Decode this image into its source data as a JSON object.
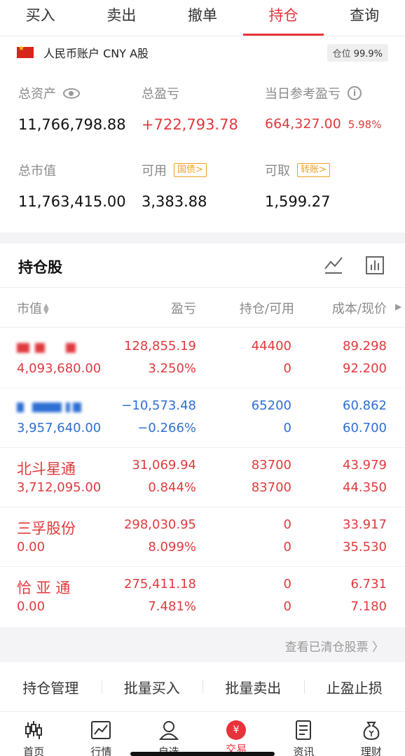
{
  "tabs": [
    {
      "label": "买入"
    },
    {
      "label": "卖出"
    },
    {
      "label": "撤单"
    },
    {
      "label": "持仓"
    },
    {
      "label": "查询"
    }
  ],
  "account": {
    "name": "人民币账户 CNY A股",
    "position_label": "仓位",
    "position_value": "99.9%",
    "total_assets_label": "总资产",
    "total_assets": "11,766,798.88",
    "total_pnl_label": "总盈亏",
    "total_pnl": "+722,793.78",
    "daily_pnl_label": "当日参考盈亏",
    "daily_pnl": "664,327.00",
    "daily_pnl_pct": "5.98%",
    "market_value_label": "总市值",
    "market_value": "11,763,415.00",
    "available_label": "可用",
    "available_tag": "国债>",
    "available": "3,383.88",
    "withdrawable_label": "可取",
    "withdrawable_tag": "转账>",
    "withdrawable": "1,599.27"
  },
  "holdings": {
    "title": "持仓股",
    "columns": [
      "市值",
      "盈亏",
      "持仓/可用",
      "成本/现价"
    ],
    "rows": [
      {
        "name": "",
        "market_value": "4,093,680.00",
        "pnl": "128,855.19",
        "pnl_pct": "3.250%",
        "holding": "44400",
        "available": "0",
        "cost": "89.298",
        "price": "92.200",
        "color": "#e03a3e"
      },
      {
        "name": "",
        "market_value": "3,957,640.00",
        "pnl": "−10,573.48",
        "pnl_pct": "−0.266%",
        "holding": "65200",
        "available": "0",
        "cost": "60.862",
        "price": "60.700",
        "color": "#2e6fd3"
      },
      {
        "name": "北斗星通",
        "market_value": "3,712,095.00",
        "pnl": "31,069.94",
        "pnl_pct": "0.844%",
        "holding": "83700",
        "available": "83700",
        "cost": "43.979",
        "price": "44.350",
        "color": "#e03a3e"
      },
      {
        "name": "三孚股份",
        "market_value": "0.00",
        "pnl": "298,030.95",
        "pnl_pct": "8.099%",
        "holding": "0",
        "available": "0",
        "cost": "33.917",
        "price": "35.530",
        "color": "#e03a3e"
      },
      {
        "name": "恰 亚 通",
        "market_value": "0.00",
        "pnl": "275,411.18",
        "pnl_pct": "7.481%",
        "holding": "0",
        "available": "0",
        "cost": "6.731",
        "price": "7.180",
        "color": "#e03a3e"
      }
    ]
  },
  "cleared_link": "查看已清仓股票 〉",
  "actions": [
    "持仓管理",
    "批量买入",
    "批量卖出",
    "止盈止损"
  ],
  "bottom_nav": [
    {
      "label": "首页",
      "icon": "candlestick-icon"
    },
    {
      "label": "行情",
      "icon": "chart-icon"
    },
    {
      "label": "自选",
      "icon": "user-icon"
    },
    {
      "label": "交易",
      "icon": "yen-icon",
      "glyph": "¥"
    },
    {
      "label": "资讯",
      "icon": "news-icon"
    },
    {
      "label": "理财",
      "icon": "moneybag-icon"
    }
  ],
  "colors": {
    "accent": "#e8333c",
    "gain": "#e03a3e",
    "loss": "#2e6fd3",
    "tag": "#f0a020"
  }
}
